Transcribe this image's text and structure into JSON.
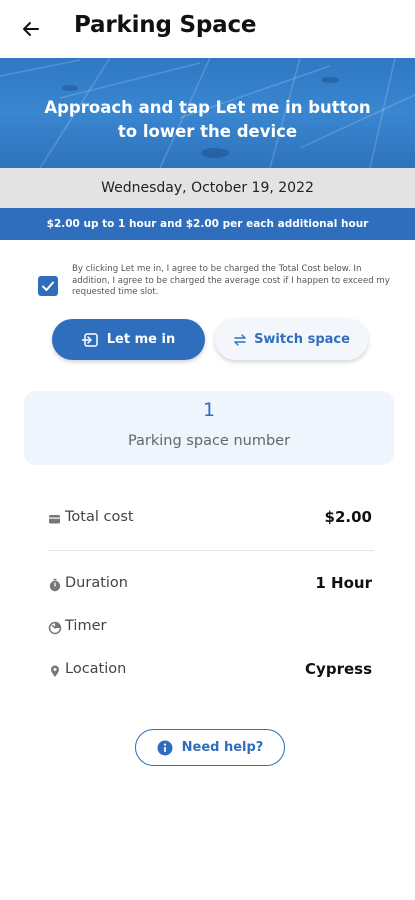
{
  "header": {
    "title": "Parking Space",
    "back_icon": "arrow-left-icon"
  },
  "banner": {
    "line1": "Approach and tap Let me in button",
    "line2": "to lower the device"
  },
  "date": "Wednesday, October 19, 2022",
  "rate": "$2.00 up to 1 hour and $2.00 per each additional hour",
  "agreement": {
    "checked": true,
    "text": "By clicking Let me in, I agree to be charged the Total Cost below. In addition, I agree to be charged the average cost if I happen to exceed my requested time slot."
  },
  "actions": {
    "let_me_in": "Let me in",
    "switch_space": "Switch space"
  },
  "space": {
    "number": "1",
    "label": "Parking space number"
  },
  "details": {
    "total_cost": {
      "label": "Total cost",
      "value": "$2.00",
      "icon": "wallet-icon"
    },
    "duration": {
      "label": "Duration",
      "value": "1 Hour",
      "icon": "stopwatch-icon"
    },
    "timer": {
      "label": "Timer",
      "value": "",
      "icon": "timer-icon"
    },
    "location": {
      "label": "Location",
      "value": "Cypress",
      "icon": "location-pin-icon"
    }
  },
  "help": {
    "label": "Need help?",
    "icon": "info-icon"
  },
  "colors": {
    "primary": "#2f6dbd",
    "banner": "#3a86d0",
    "date_bar": "#e3e3e3",
    "card_bg": "#eef5fc"
  }
}
